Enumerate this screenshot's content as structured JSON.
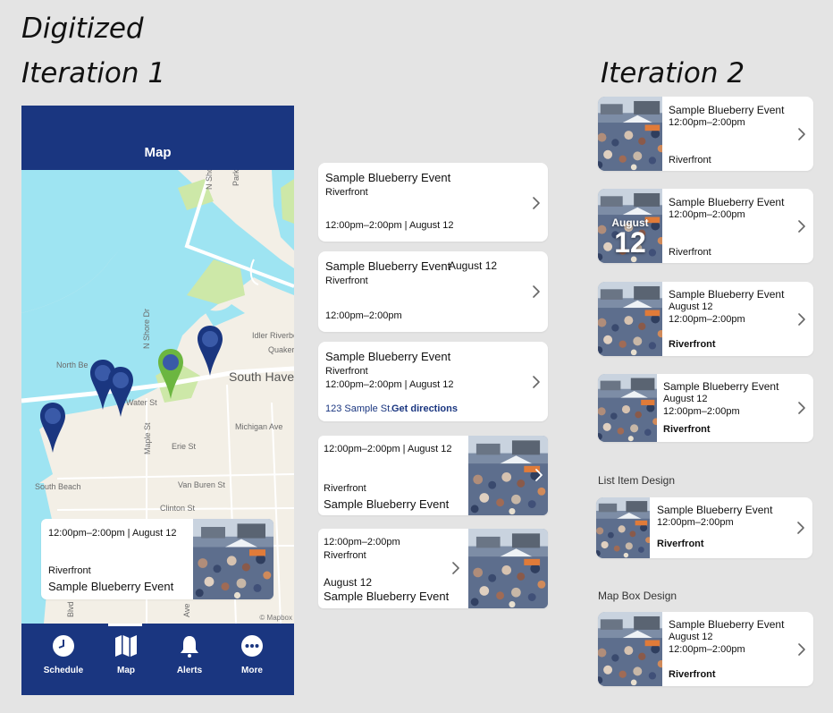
{
  "headings": {
    "digitized": "Digitized",
    "iteration1": "Iteration 1",
    "iteration2": "Iteration 2",
    "list_item_design": "List Item Design",
    "map_box_design": "Map Box Design"
  },
  "phone": {
    "title": "Map",
    "map_labels": {
      "north_shore_dr": "N Shore Dr",
      "north_shore_dr_2": "N Shore Dr",
      "park": "Park",
      "north_beach": "North Be",
      "idler_riverboat": "Idler Riverboat",
      "quaker": "Quaker",
      "south_haven": "South Have",
      "water_st": "Water St",
      "maple_st": "Maple St",
      "michigan_ave": "Michigan Ave",
      "erie_st": "Erie St",
      "south_beach": "South Beach",
      "van_buren_st": "Van Buren St",
      "clinton_st": "Clinton St",
      "blvd": "Blvd",
      "ave": "Ave",
      "attribution": "© Mapbox"
    },
    "map_card": {
      "time": "12:00pm–2:00pm | August 12",
      "location": "Riverfront",
      "title": "Sample Blueberry Event"
    },
    "tabs": [
      {
        "label": "Schedule",
        "icon": "clock-icon"
      },
      {
        "label": "Map",
        "icon": "map-icon"
      },
      {
        "label": "Alerts",
        "icon": "bell-icon"
      },
      {
        "label": "More",
        "icon": "more-icon"
      }
    ],
    "colors": {
      "brand": "#1a3680",
      "water": "#9ee4f2",
      "land": "#f3efe6",
      "park": "#cde8a8",
      "green_pin": "#6cb640"
    }
  },
  "iteration1_cards": [
    {
      "title": "Sample Blueberry Event",
      "location": "Riverfront",
      "time": "12:00pm–2:00pm | August 12"
    },
    {
      "title": "Sample Blueberry Event",
      "date": "August 12",
      "location": "Riverfront",
      "time": "12:00pm–2:00pm"
    },
    {
      "title": "Sample Blueberry Event",
      "location": "Riverfront",
      "time": "12:00pm–2:00pm | August 12",
      "address": "123 Sample St.",
      "directions": "Get directions"
    },
    {
      "time": "12:00pm–2:00pm | August 12",
      "location": "Riverfront",
      "title": "Sample Blueberry Event"
    },
    {
      "time": "12:00pm–2:00pm",
      "location": "Riverfront",
      "date": "August 12",
      "title": "Sample Blueberry Event"
    }
  ],
  "iteration2_cards": [
    {
      "title": "Sample Blueberry Event",
      "time": "12:00pm–2:00pm",
      "location": "Riverfront"
    },
    {
      "title": "Sample Blueberry Event",
      "time": "12:00pm–2:00pm",
      "location": "Riverfront",
      "overlay_month": "August",
      "overlay_day": "12"
    },
    {
      "title": "Sample Blueberry Event",
      "date": "August 12",
      "time": "12:00pm–2:00pm",
      "location": "Riverfront"
    },
    {
      "title": "Sample Blueberry Event",
      "date": "August 12",
      "time": "12:00pm–2:00pm",
      "location": "Riverfront"
    },
    {
      "title": "Sample Blueberry Event",
      "time": "12:00pm–2:00pm",
      "location": "Riverfront"
    },
    {
      "title": "Sample Blueberry Event",
      "date": "August 12",
      "time": "12:00pm–2:00pm",
      "location": "Riverfront"
    }
  ]
}
